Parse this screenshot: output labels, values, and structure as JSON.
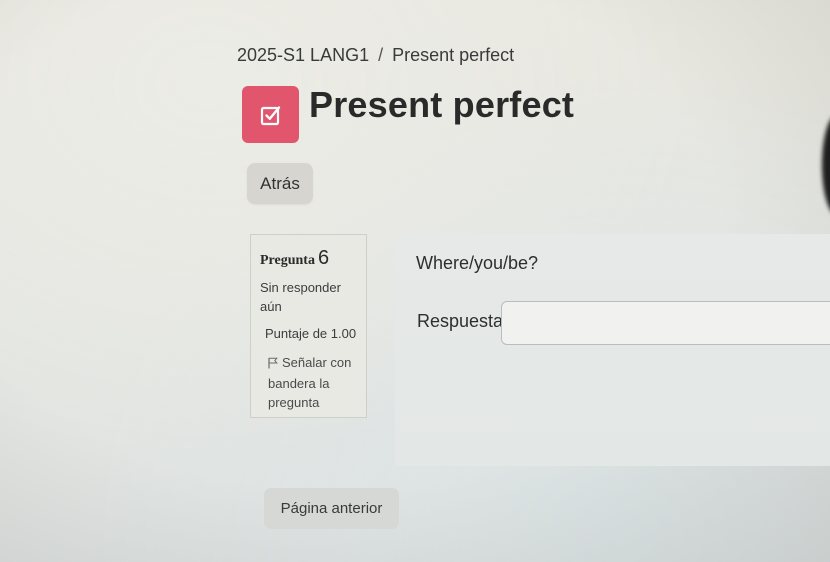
{
  "breadcrumb": {
    "course": "2025-S1 LANG1",
    "separator": "/",
    "current": "Present perfect"
  },
  "page": {
    "title": "Present perfect",
    "icon": "assignment-check-icon",
    "icon_color": "#e2566d"
  },
  "nav": {
    "back_label": "Atrás",
    "previous_page_label": "Página anterior"
  },
  "question": {
    "label": "Pregunta",
    "number": "6",
    "state": "Sin responder aún",
    "grade": "Puntaje de 1.00",
    "flag_label": "Señalar con bandera la pregunta",
    "flag_icon": "flag-icon",
    "text": "Where/you/be?",
    "answer_label": "Respuesta:",
    "answer_value": ""
  }
}
